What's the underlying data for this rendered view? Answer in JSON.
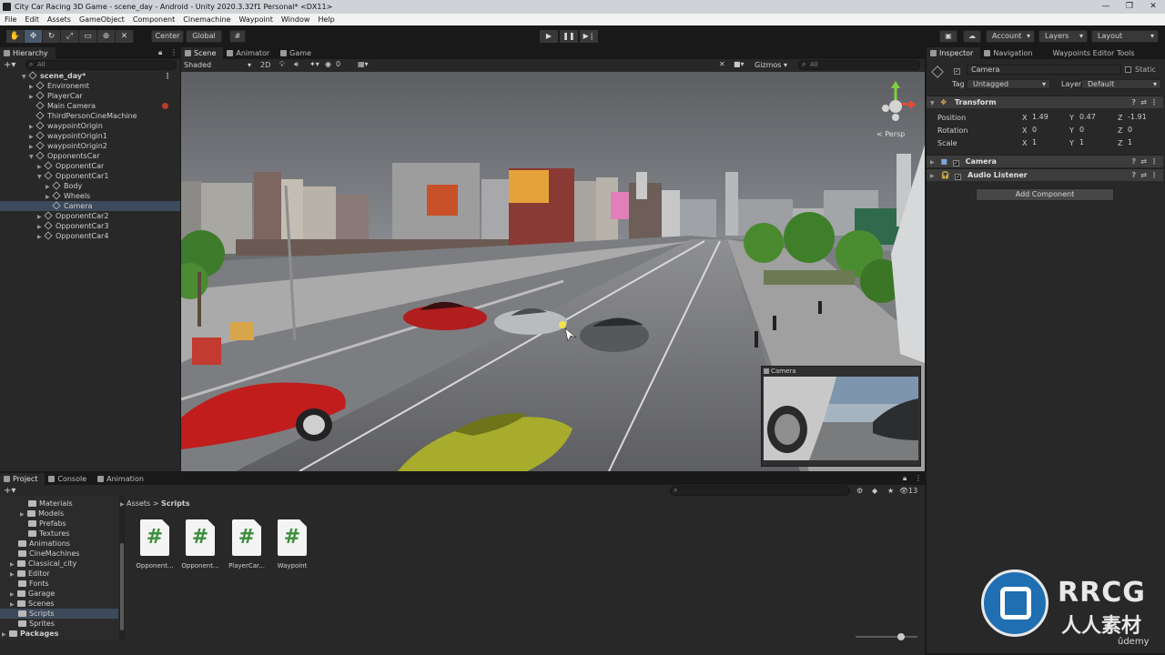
{
  "window": {
    "title": "City Car Racing 3D Game - scene_day - Android - Unity 2020.3.32f1 Personal* <DX11>"
  },
  "menu": [
    "File",
    "Edit",
    "Assets",
    "GameObject",
    "Component",
    "Cinemachine",
    "Waypoint",
    "Window",
    "Help"
  ],
  "toolbar": {
    "pivot": "Center",
    "space": "Global",
    "account": "Account",
    "layers": "Layers",
    "layout": "Layout"
  },
  "hierarchy": {
    "tab": "Hierarchy",
    "search_placeholder": "All",
    "scene": "scene_day*",
    "items": [
      {
        "label": "Environemt"
      },
      {
        "label": "PlayerCar"
      },
      {
        "label": "Main Camera"
      },
      {
        "label": "ThirdPersonCineMachine"
      },
      {
        "label": "waypointOrigin"
      },
      {
        "label": "waypointOrigin1"
      },
      {
        "label": "waypointOrigin2"
      },
      {
        "label": "OpponentsCar"
      },
      {
        "label": "OpponentCar"
      },
      {
        "label": "OpponentCar1"
      },
      {
        "label": "Body"
      },
      {
        "label": "Wheels"
      },
      {
        "label": "Camera"
      },
      {
        "label": "OpponentCar2"
      },
      {
        "label": "OpponentCar3"
      },
      {
        "label": "OpponentCar4"
      }
    ]
  },
  "scene_tabs": [
    "Scene",
    "Animator",
    "Game"
  ],
  "scene_bar": {
    "shading": "Shaded",
    "mode2d": "2D",
    "gizmos": "Gizmos",
    "search_placeholder": "All",
    "fx_count": "0"
  },
  "scene_gizmo": {
    "persp": "< Persp"
  },
  "camera_preview": {
    "title": "Camera"
  },
  "inspector": {
    "tabs": [
      "Inspector",
      "Navigation",
      "Waypoints Editor Tools"
    ],
    "object_name": "Camera",
    "static_label": "Static",
    "tag_label": "Tag",
    "tag_value": "Untagged",
    "layer_label": "Layer",
    "layer_value": "Default",
    "transform": {
      "title": "Transform",
      "rows": [
        {
          "label": "Position",
          "x": "1.49",
          "y": "0.47",
          "z": "-1.91"
        },
        {
          "label": "Rotation",
          "x": "0",
          "y": "0",
          "z": "0"
        },
        {
          "label": "Scale",
          "x": "1",
          "y": "1",
          "z": "1"
        }
      ]
    },
    "camera_component": "Camera",
    "audio_component": "Audio Listener",
    "add_component": "Add Component",
    "axis_x": "X",
    "axis_y": "Y",
    "axis_z": "Z"
  },
  "project": {
    "tabs": [
      "Project",
      "Console",
      "Animation"
    ],
    "breadcrumb_root": "Assets",
    "breadcrumb_sep": ">",
    "breadcrumb_current": "Scripts",
    "hidden_count": "13",
    "folders": [
      {
        "label": "Materials"
      },
      {
        "label": "Models"
      },
      {
        "label": "Prefabs"
      },
      {
        "label": "Textures"
      },
      {
        "label": "Animations"
      },
      {
        "label": "CineMachines"
      },
      {
        "label": "Classical_city"
      },
      {
        "label": "Editor"
      },
      {
        "label": "Fonts"
      },
      {
        "label": "Garage"
      },
      {
        "label": "Scenes"
      },
      {
        "label": "Scripts"
      },
      {
        "label": "Sprites"
      },
      {
        "label": "Packages"
      }
    ],
    "assets": [
      {
        "label": "Opponent..."
      },
      {
        "label": "Opponent..."
      },
      {
        "label": "PlayerCar..."
      },
      {
        "label": "Waypoint"
      }
    ],
    "script_glyph": "#"
  },
  "watermarks": {
    "brand": "RRCG",
    "sub": "人人素材",
    "udemy": "ûdemy"
  }
}
